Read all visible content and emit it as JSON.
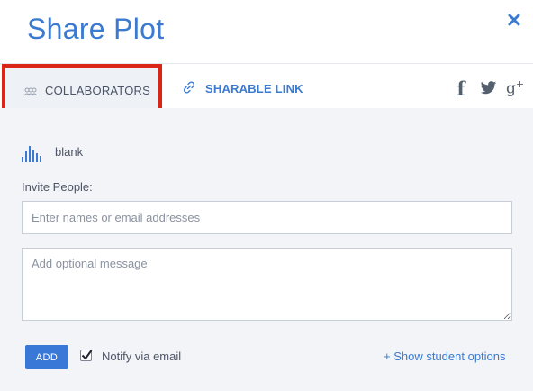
{
  "dialog": {
    "title": "Share Plot",
    "close_icon": "close-icon"
  },
  "tabs": [
    {
      "label": "COLLABORATORS",
      "icon": "people-icon",
      "active": true
    },
    {
      "label": "SHARABLE LINK",
      "icon": "link-icon",
      "active": false
    }
  ],
  "social": {
    "facebook": "f",
    "twitter_icon": "twitter-icon",
    "googleplus": "g",
    "googleplus_sup": "+"
  },
  "plot": {
    "icon": "bar-chart-icon",
    "name": "blank"
  },
  "invite": {
    "label": "Invite People:",
    "names_placeholder": "Enter names or email addresses",
    "message_placeholder": "Add optional message"
  },
  "footer": {
    "add_label": "ADD",
    "notify_label": "Notify via email",
    "notify_checked": true,
    "student_link": "+ Show student options"
  },
  "colors": {
    "accent": "#3a7ad0",
    "button": "#3a78d8",
    "highlight_border": "#d92616",
    "body_bg": "#f2f4f7"
  }
}
